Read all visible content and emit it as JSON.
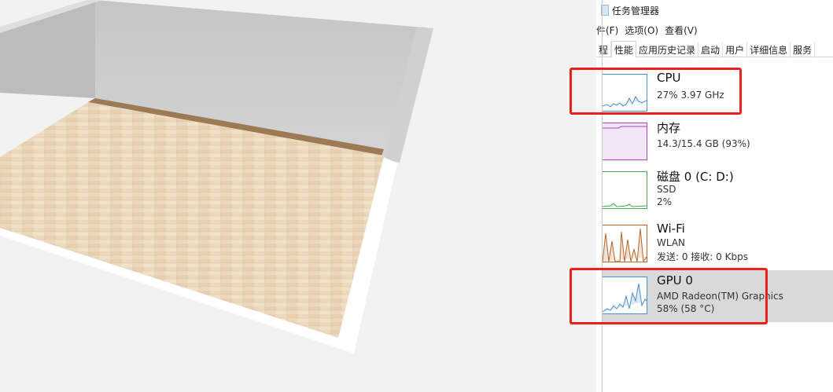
{
  "window": {
    "title": "任务管理器",
    "menu": [
      "文件(F)",
      "选项(O)",
      "查看(V)"
    ],
    "menu_visible": [
      "件(F)",
      "选项(O)",
      "查看(V)"
    ]
  },
  "tabs": [
    {
      "label": "程",
      "active": false
    },
    {
      "label": "性能",
      "active": true
    },
    {
      "label": "应用历史记录",
      "active": false
    },
    {
      "label": "启动",
      "active": false
    },
    {
      "label": "用户",
      "active": false
    },
    {
      "label": "详细信息",
      "active": false
    },
    {
      "label": "服务",
      "active": false
    }
  ],
  "performance": [
    {
      "id": "cpu",
      "name": "CPU",
      "line1": "27%  3.97 GHz",
      "line2": "",
      "color": "#4a90c9",
      "selected": false
    },
    {
      "id": "memory",
      "name": "内存",
      "line1": "14.3/15.4 GB (93%)",
      "line2": "",
      "color": "#a54bb5",
      "selected": false
    },
    {
      "id": "disk",
      "name": "磁盘 0 (C: D:)",
      "line1": "SSD",
      "line2": "2%",
      "color": "#4ca64c",
      "selected": false
    },
    {
      "id": "wifi",
      "name": "Wi-Fi",
      "line1": "WLAN",
      "line2": "发送: 0  接收: 0 Kbps",
      "color": "#b5652a",
      "selected": false
    },
    {
      "id": "gpu",
      "name": "GPU 0",
      "line1": "AMD Radeon(TM) Graphics",
      "line2": "58%  (58 °C)",
      "color": "#4a90c9",
      "selected": true
    }
  ],
  "annotations": {
    "highlight_color": "#e8211a",
    "highlighted": [
      "cpu",
      "gpu"
    ]
  }
}
